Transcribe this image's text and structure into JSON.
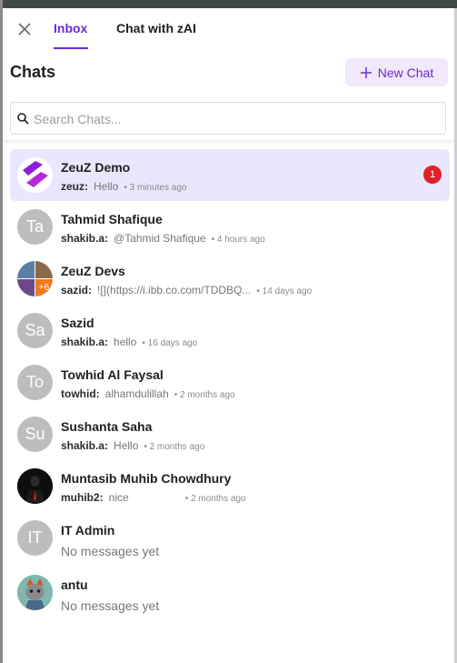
{
  "tabs": {
    "inbox": "Inbox",
    "chat_with_zai": "Chat with zAI"
  },
  "header": {
    "title": "Chats",
    "new_chat_label": "New Chat"
  },
  "search": {
    "placeholder": "Search Chats..."
  },
  "colors": {
    "accent": "#6b2bd6",
    "active_row": "#e8e7fd",
    "badge": "#e0202a"
  },
  "chats": [
    {
      "name": "ZeuZ Demo",
      "sender": "zeuz:",
      "message": "Hello",
      "time": "• 3 minutes ago",
      "unread": "1",
      "avatar": "zeuz-logo"
    },
    {
      "name": "Tahmid Shafique",
      "sender": "shakib.a:",
      "message": "@Tahmid Shafique",
      "time": "• 4 hours ago",
      "initials": "Ta"
    },
    {
      "name": "ZeuZ Devs",
      "sender": "sazid:",
      "message": "![](https://i.ibb.co.com/TDDBQ...",
      "time": "• 14 days ago",
      "group_more": "+6"
    },
    {
      "name": "Sazid",
      "sender": "shakib.a:",
      "message": "hello",
      "time": "• 16 days ago",
      "initials": "Sa"
    },
    {
      "name": "Towhid Al Faysal",
      "sender": "towhid:",
      "message": "alhamdulillah",
      "time": "• 2 months ago",
      "initials": "To"
    },
    {
      "name": "Sushanta Saha",
      "sender": "shakib.a:",
      "message": "Hello",
      "time": "• 2 months ago",
      "initials": "Su"
    },
    {
      "name": "Muntasib Muhib Chowdhury",
      "sender": "muhib2:",
      "message": "nice",
      "time": "• 2 months ago",
      "avatar": "photo-dark"
    },
    {
      "name": "IT Admin",
      "no_messages": "No messages yet",
      "initials": "IT"
    },
    {
      "name": "antu",
      "no_messages": "No messages yet",
      "avatar": "cat-photo"
    }
  ]
}
